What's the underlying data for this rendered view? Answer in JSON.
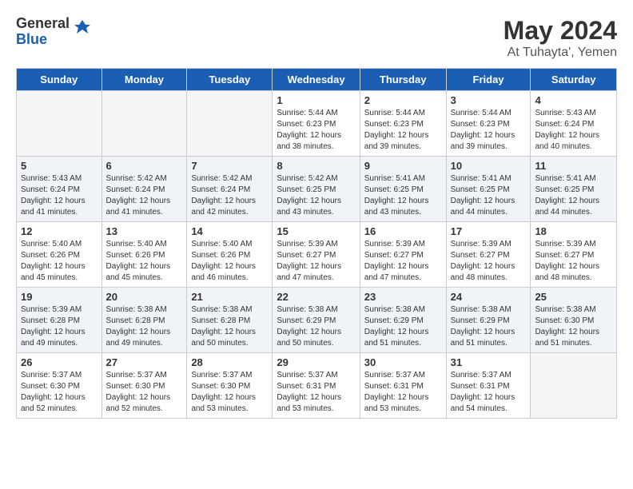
{
  "logo": {
    "general": "General",
    "blue": "Blue"
  },
  "title": {
    "month_year": "May 2024",
    "location": "At Tuhayta', Yemen"
  },
  "days_of_week": [
    "Sunday",
    "Monday",
    "Tuesday",
    "Wednesday",
    "Thursday",
    "Friday",
    "Saturday"
  ],
  "weeks": [
    [
      {
        "day": "",
        "info": ""
      },
      {
        "day": "",
        "info": ""
      },
      {
        "day": "",
        "info": ""
      },
      {
        "day": "1",
        "info": "Sunrise: 5:44 AM\nSunset: 6:23 PM\nDaylight: 12 hours\nand 38 minutes."
      },
      {
        "day": "2",
        "info": "Sunrise: 5:44 AM\nSunset: 6:23 PM\nDaylight: 12 hours\nand 39 minutes."
      },
      {
        "day": "3",
        "info": "Sunrise: 5:44 AM\nSunset: 6:23 PM\nDaylight: 12 hours\nand 39 minutes."
      },
      {
        "day": "4",
        "info": "Sunrise: 5:43 AM\nSunset: 6:24 PM\nDaylight: 12 hours\nand 40 minutes."
      }
    ],
    [
      {
        "day": "5",
        "info": "Sunrise: 5:43 AM\nSunset: 6:24 PM\nDaylight: 12 hours\nand 41 minutes."
      },
      {
        "day": "6",
        "info": "Sunrise: 5:42 AM\nSunset: 6:24 PM\nDaylight: 12 hours\nand 41 minutes."
      },
      {
        "day": "7",
        "info": "Sunrise: 5:42 AM\nSunset: 6:24 PM\nDaylight: 12 hours\nand 42 minutes."
      },
      {
        "day": "8",
        "info": "Sunrise: 5:42 AM\nSunset: 6:25 PM\nDaylight: 12 hours\nand 43 minutes."
      },
      {
        "day": "9",
        "info": "Sunrise: 5:41 AM\nSunset: 6:25 PM\nDaylight: 12 hours\nand 43 minutes."
      },
      {
        "day": "10",
        "info": "Sunrise: 5:41 AM\nSunset: 6:25 PM\nDaylight: 12 hours\nand 44 minutes."
      },
      {
        "day": "11",
        "info": "Sunrise: 5:41 AM\nSunset: 6:25 PM\nDaylight: 12 hours\nand 44 minutes."
      }
    ],
    [
      {
        "day": "12",
        "info": "Sunrise: 5:40 AM\nSunset: 6:26 PM\nDaylight: 12 hours\nand 45 minutes."
      },
      {
        "day": "13",
        "info": "Sunrise: 5:40 AM\nSunset: 6:26 PM\nDaylight: 12 hours\nand 45 minutes."
      },
      {
        "day": "14",
        "info": "Sunrise: 5:40 AM\nSunset: 6:26 PM\nDaylight: 12 hours\nand 46 minutes."
      },
      {
        "day": "15",
        "info": "Sunrise: 5:39 AM\nSunset: 6:27 PM\nDaylight: 12 hours\nand 47 minutes."
      },
      {
        "day": "16",
        "info": "Sunrise: 5:39 AM\nSunset: 6:27 PM\nDaylight: 12 hours\nand 47 minutes."
      },
      {
        "day": "17",
        "info": "Sunrise: 5:39 AM\nSunset: 6:27 PM\nDaylight: 12 hours\nand 48 minutes."
      },
      {
        "day": "18",
        "info": "Sunrise: 5:39 AM\nSunset: 6:27 PM\nDaylight: 12 hours\nand 48 minutes."
      }
    ],
    [
      {
        "day": "19",
        "info": "Sunrise: 5:39 AM\nSunset: 6:28 PM\nDaylight: 12 hours\nand 49 minutes."
      },
      {
        "day": "20",
        "info": "Sunrise: 5:38 AM\nSunset: 6:28 PM\nDaylight: 12 hours\nand 49 minutes."
      },
      {
        "day": "21",
        "info": "Sunrise: 5:38 AM\nSunset: 6:28 PM\nDaylight: 12 hours\nand 50 minutes."
      },
      {
        "day": "22",
        "info": "Sunrise: 5:38 AM\nSunset: 6:29 PM\nDaylight: 12 hours\nand 50 minutes."
      },
      {
        "day": "23",
        "info": "Sunrise: 5:38 AM\nSunset: 6:29 PM\nDaylight: 12 hours\nand 51 minutes."
      },
      {
        "day": "24",
        "info": "Sunrise: 5:38 AM\nSunset: 6:29 PM\nDaylight: 12 hours\nand 51 minutes."
      },
      {
        "day": "25",
        "info": "Sunrise: 5:38 AM\nSunset: 6:30 PM\nDaylight: 12 hours\nand 51 minutes."
      }
    ],
    [
      {
        "day": "26",
        "info": "Sunrise: 5:37 AM\nSunset: 6:30 PM\nDaylight: 12 hours\nand 52 minutes."
      },
      {
        "day": "27",
        "info": "Sunrise: 5:37 AM\nSunset: 6:30 PM\nDaylight: 12 hours\nand 52 minutes."
      },
      {
        "day": "28",
        "info": "Sunrise: 5:37 AM\nSunset: 6:30 PM\nDaylight: 12 hours\nand 53 minutes."
      },
      {
        "day": "29",
        "info": "Sunrise: 5:37 AM\nSunset: 6:31 PM\nDaylight: 12 hours\nand 53 minutes."
      },
      {
        "day": "30",
        "info": "Sunrise: 5:37 AM\nSunset: 6:31 PM\nDaylight: 12 hours\nand 53 minutes."
      },
      {
        "day": "31",
        "info": "Sunrise: 5:37 AM\nSunset: 6:31 PM\nDaylight: 12 hours\nand 54 minutes."
      },
      {
        "day": "",
        "info": ""
      }
    ]
  ]
}
